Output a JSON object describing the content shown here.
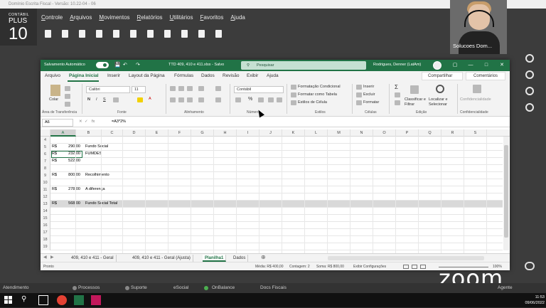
{
  "app": {
    "window_title": "Domínio Escrita Fiscal - Versão: 10.22-04 - 06",
    "logo_small": "CONTÁBIL",
    "logo_plus": "PLUS",
    "logo_ten": "10",
    "menu": [
      "Controle",
      "Arquivos",
      "Movimentos",
      "Relatórios",
      "Utilitários",
      "Favoritos",
      "Ajuda"
    ]
  },
  "zoom": {
    "participant_name": "Solucoes Dom...",
    "logo": "zoom"
  },
  "excel": {
    "autosave_label": "Salvamento Automático",
    "file_title": "TTD 409, 410 e 411.xlsx - Salvo",
    "search_placeholder": "Pesquisar",
    "user": "Rodrigues, Denner (LatAm)",
    "tabs": [
      "Arquivo",
      "Página Inicial",
      "Inserir",
      "Layout da Página",
      "Fórmulas",
      "Dados",
      "Revisão",
      "Exibir",
      "Ajuda"
    ],
    "share_label": "Compartilhar",
    "comments_label": "Comentários",
    "ribbon": {
      "paste_label": "Colar",
      "font_name": "Calibri",
      "font_size": "11",
      "number_format": "Contábil",
      "conditional_format": "Formatação Condicional",
      "format_table": "Formatar como Tabela",
      "cell_styles": "Estilos de Célula",
      "insert": "Inserir",
      "delete": "Excluir",
      "format": "Formatar",
      "sort_filter": "Classificar e Filtrar",
      "find_select": "Localizar e Selecionar",
      "confidentiality": "Confidencialidade",
      "groups": [
        "Área de Transferência",
        "Fonte",
        "Alinhamento",
        "Número",
        "Estilos",
        "Células",
        "Edição",
        "Confidencialidade"
      ]
    },
    "name_box": "A6",
    "fx_label": "fx",
    "formula": "=A3*2%",
    "columns": [
      "A",
      "B",
      "C",
      "D",
      "E",
      "F",
      "G",
      "H",
      "I",
      "J",
      "K",
      "L",
      "M",
      "N",
      "O",
      "P",
      "Q",
      "R",
      "S"
    ],
    "rows": [
      {
        "n": "4",
        "cur": "",
        "val": "",
        "desc": ""
      },
      {
        "n": "5",
        "cur": "R$",
        "val": "290,00",
        "desc": "Fundo Social"
      },
      {
        "n": "6",
        "cur": "R$",
        "val": "232,00",
        "desc": "FUMDES"
      },
      {
        "n": "7",
        "cur": "R$",
        "val": "522,00",
        "desc": ""
      },
      {
        "n": "8",
        "cur": "",
        "val": "",
        "desc": ""
      },
      {
        "n": "9",
        "cur": "R$",
        "val": "800,00",
        "desc": "Recolhimento"
      },
      {
        "n": "10",
        "cur": "",
        "val": "",
        "desc": ""
      },
      {
        "n": "11",
        "cur": "R$",
        "val": "278,00",
        "desc": "A diferença"
      },
      {
        "n": "12",
        "cur": "",
        "val": "",
        "desc": ""
      },
      {
        "n": "13",
        "cur": "R$",
        "val": "568,00",
        "desc": "Fundo Social Total"
      },
      {
        "n": "14",
        "cur": "",
        "val": "",
        "desc": ""
      },
      {
        "n": "15",
        "cur": "",
        "val": "",
        "desc": ""
      },
      {
        "n": "16",
        "cur": "",
        "val": "",
        "desc": ""
      },
      {
        "n": "17",
        "cur": "",
        "val": "",
        "desc": ""
      },
      {
        "n": "18",
        "cur": "",
        "val": "",
        "desc": ""
      },
      {
        "n": "19",
        "cur": "",
        "val": "",
        "desc": ""
      }
    ],
    "sheet_tabs": [
      "409, 410 e 411 - Geral",
      "409, 410 e 411 - Geral (Ajusta)",
      "Planilha1",
      "Dados"
    ],
    "status": {
      "mode": "Pronto",
      "average": "Média: R$ 400,00",
      "count": "Contagem: 2",
      "sum": "Soma: R$ 800,00",
      "display": "Exibir Configurações",
      "zoom": "100%"
    }
  },
  "bottom_status": [
    "Atendimento",
    "Processos",
    "Suporte",
    "eSocial",
    "OnBalance",
    "Docs Fiscais",
    "Agente"
  ],
  "clock": {
    "time": "11:53",
    "date": "09/06/2022"
  }
}
